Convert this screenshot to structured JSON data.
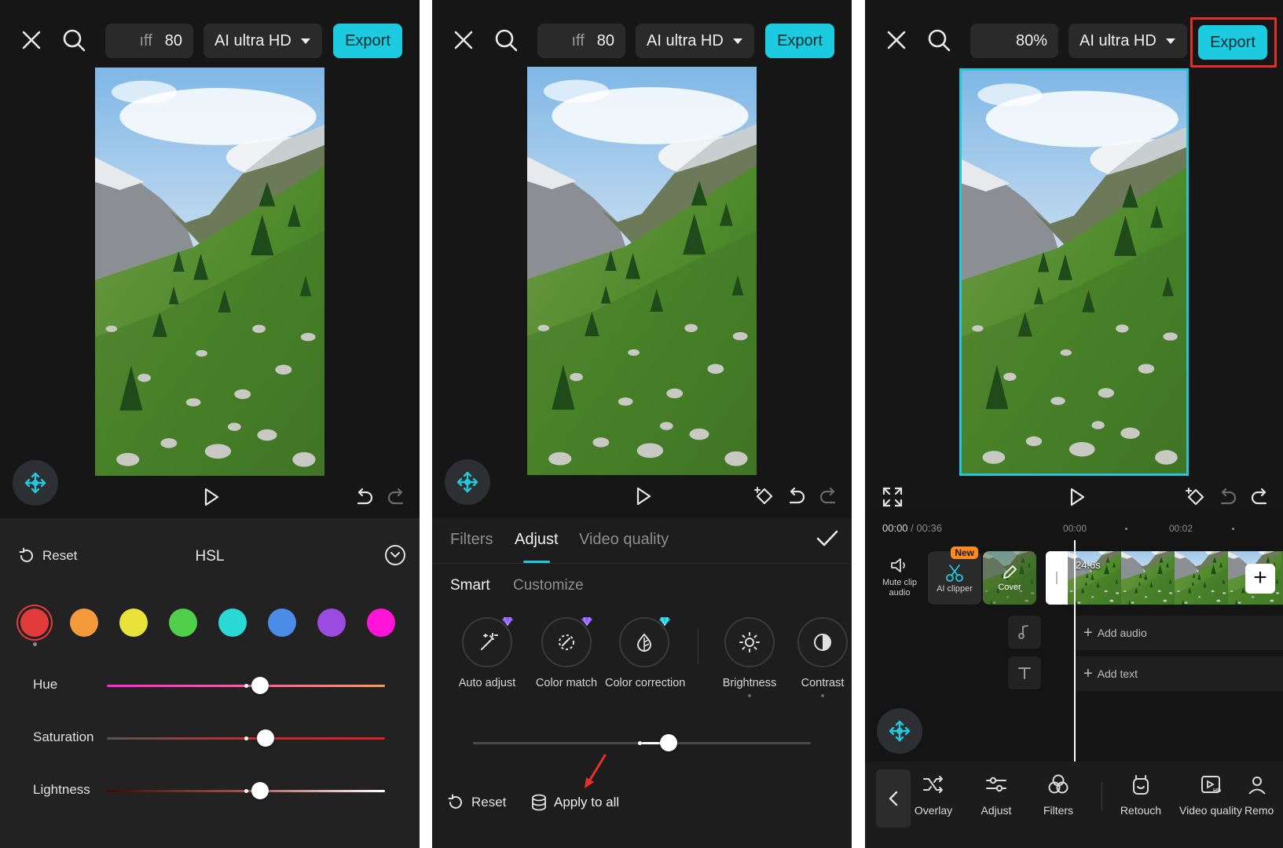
{
  "colors": {
    "accent": "#1ccbe0",
    "highlight": "#e0302a",
    "badge": "#ff8a1f"
  },
  "icons": [
    "close-icon",
    "search-icon",
    "chevron-down-icon",
    "move-icon",
    "play-icon",
    "undo-icon",
    "redo-icon",
    "keyframe-icon",
    "fullscreen-icon",
    "reset-icon",
    "check-icon",
    "apply-all-icon",
    "arrow-pointer-icon"
  ],
  "panel1": {
    "zoom_ghost": "ıff",
    "zoom_value": "80",
    "quality": "AI ultra HD",
    "export": "Export",
    "sheet": {
      "reset": "Reset",
      "title": "HSL",
      "swatches": [
        "#e23b3b",
        "#f39a3c",
        "#e8e23a",
        "#4fcf4a",
        "#2ad9d6",
        "#4b8de6",
        "#9a4be0",
        "#ff14d8"
      ],
      "sliders": [
        {
          "label": "Hue",
          "value": 0.55
        },
        {
          "label": "Saturation",
          "value": 0.57
        },
        {
          "label": "Lightness",
          "value": 0.55
        }
      ]
    }
  },
  "panel2": {
    "zoom_ghost": "ıff",
    "zoom_value": "80",
    "quality": "AI ultra HD",
    "export": "Export",
    "tabs": [
      "Filters",
      "Adjust",
      "Video quality"
    ],
    "active_tab": "Adjust",
    "subtabs": [
      "Smart",
      "Customize"
    ],
    "active_subtab": "Smart",
    "tools": [
      {
        "label": "Auto adjust",
        "gem": true
      },
      {
        "label": "Color match",
        "gem": true
      },
      {
        "label": "Color correction",
        "gem": true
      },
      {
        "label": "Brightness",
        "gem": false
      },
      {
        "label": "Contrast",
        "gem": false
      }
    ],
    "slider_value": 0.58,
    "reset": "Reset",
    "apply_all": "Apply to all"
  },
  "panel3": {
    "zoom_value": "80%",
    "quality": "AI ultra HD",
    "export": "Export",
    "time_current": "00:00",
    "time_sep": "/",
    "time_total": "00:36",
    "ruler": [
      "00:00",
      "00:02"
    ],
    "clip_duration": "24.6s",
    "tools": {
      "mute": "Mute clip audio",
      "ai_clipper": "AI clipper",
      "new_badge": "New",
      "cover": "Cover"
    },
    "add_audio": "Add audio",
    "add_text": "Add text",
    "toolbar": [
      "Overlay",
      "Adjust",
      "Filters",
      "Retouch",
      "Video quality",
      "Remo"
    ]
  }
}
